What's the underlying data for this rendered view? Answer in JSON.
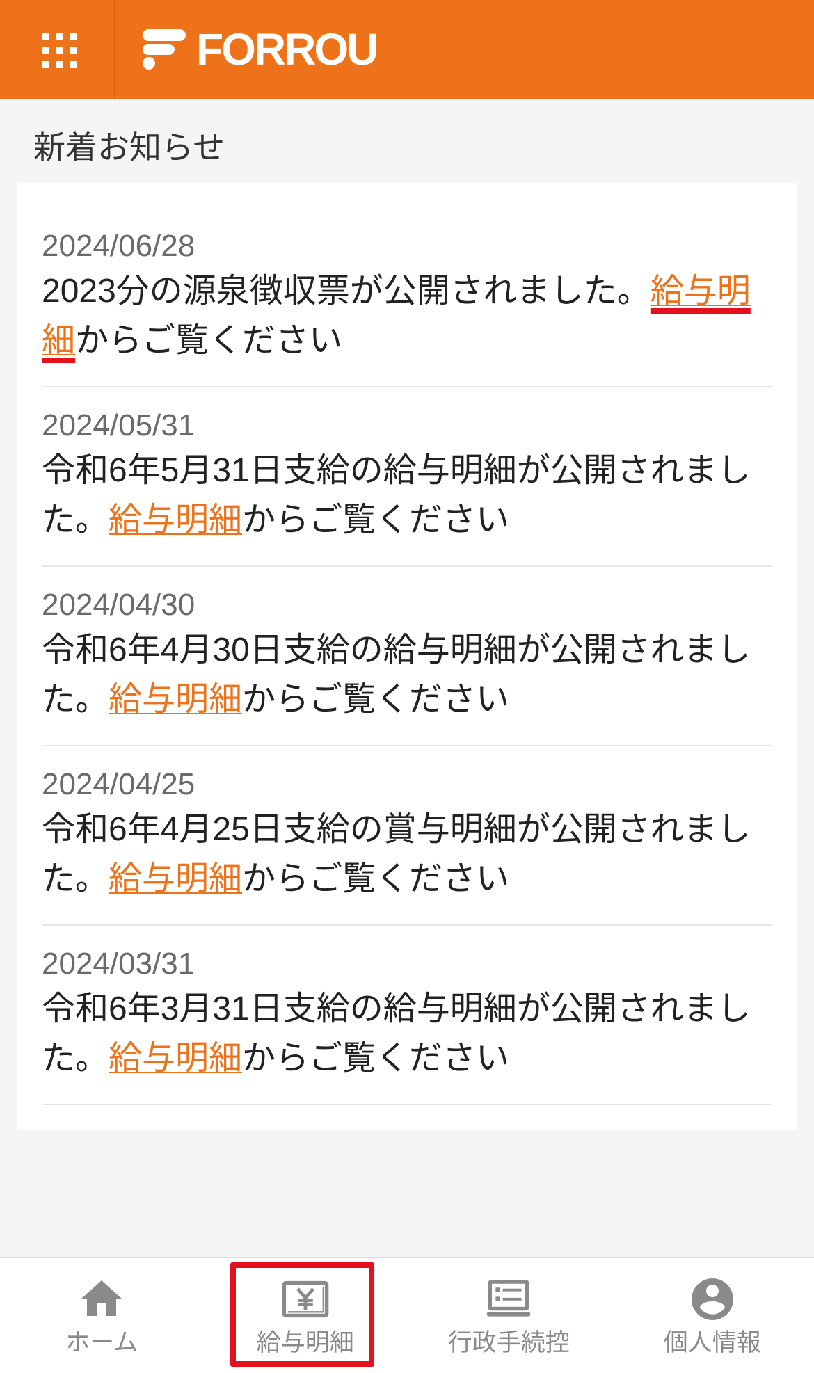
{
  "theme": {
    "header_bg": "#EE7219",
    "link_color": "#EE7219",
    "annotation_red": "#E3101E",
    "nav_gray": "#8A8A8A"
  },
  "header": {
    "menu_icon": "grid-menu-icon",
    "logo_icon": "forrou-f-logo-icon",
    "logo_text": "FORROU"
  },
  "section": {
    "title": "新着お知らせ"
  },
  "notices": [
    {
      "date": "2024/06/28",
      "text_before": "2023分の源泉徴収票が公開されました。",
      "link_text": "給与明細",
      "text_after": "からご覧ください"
    },
    {
      "date": "2024/05/31",
      "text_before": "令和6年5月31日支給の給与明細が公開されました。",
      "link_text": "給与明細",
      "text_after": "からご覧ください"
    },
    {
      "date": "2024/04/30",
      "text_before": "令和6年4月30日支給の給与明細が公開されました。",
      "link_text": "給与明細",
      "text_after": "からご覧ください"
    },
    {
      "date": "2024/04/25",
      "text_before": "令和6年4月25日支給の賞与明細が公開されました。",
      "link_text": "給与明細",
      "text_after": "からご覧ください"
    },
    {
      "date": "2024/03/31",
      "text_before": "令和6年3月31日支給の給与明細が公開されました。",
      "link_text": "給与明細",
      "text_after": "からご覧ください"
    }
  ],
  "bottom_nav": {
    "items": [
      {
        "label": "ホーム",
        "icon": "home-icon"
      },
      {
        "label": "給与明細",
        "icon": "yen-payslip-icon"
      },
      {
        "label": "行政手続控",
        "icon": "document-list-icon"
      },
      {
        "label": "個人情報",
        "icon": "user-circle-icon"
      }
    ]
  }
}
